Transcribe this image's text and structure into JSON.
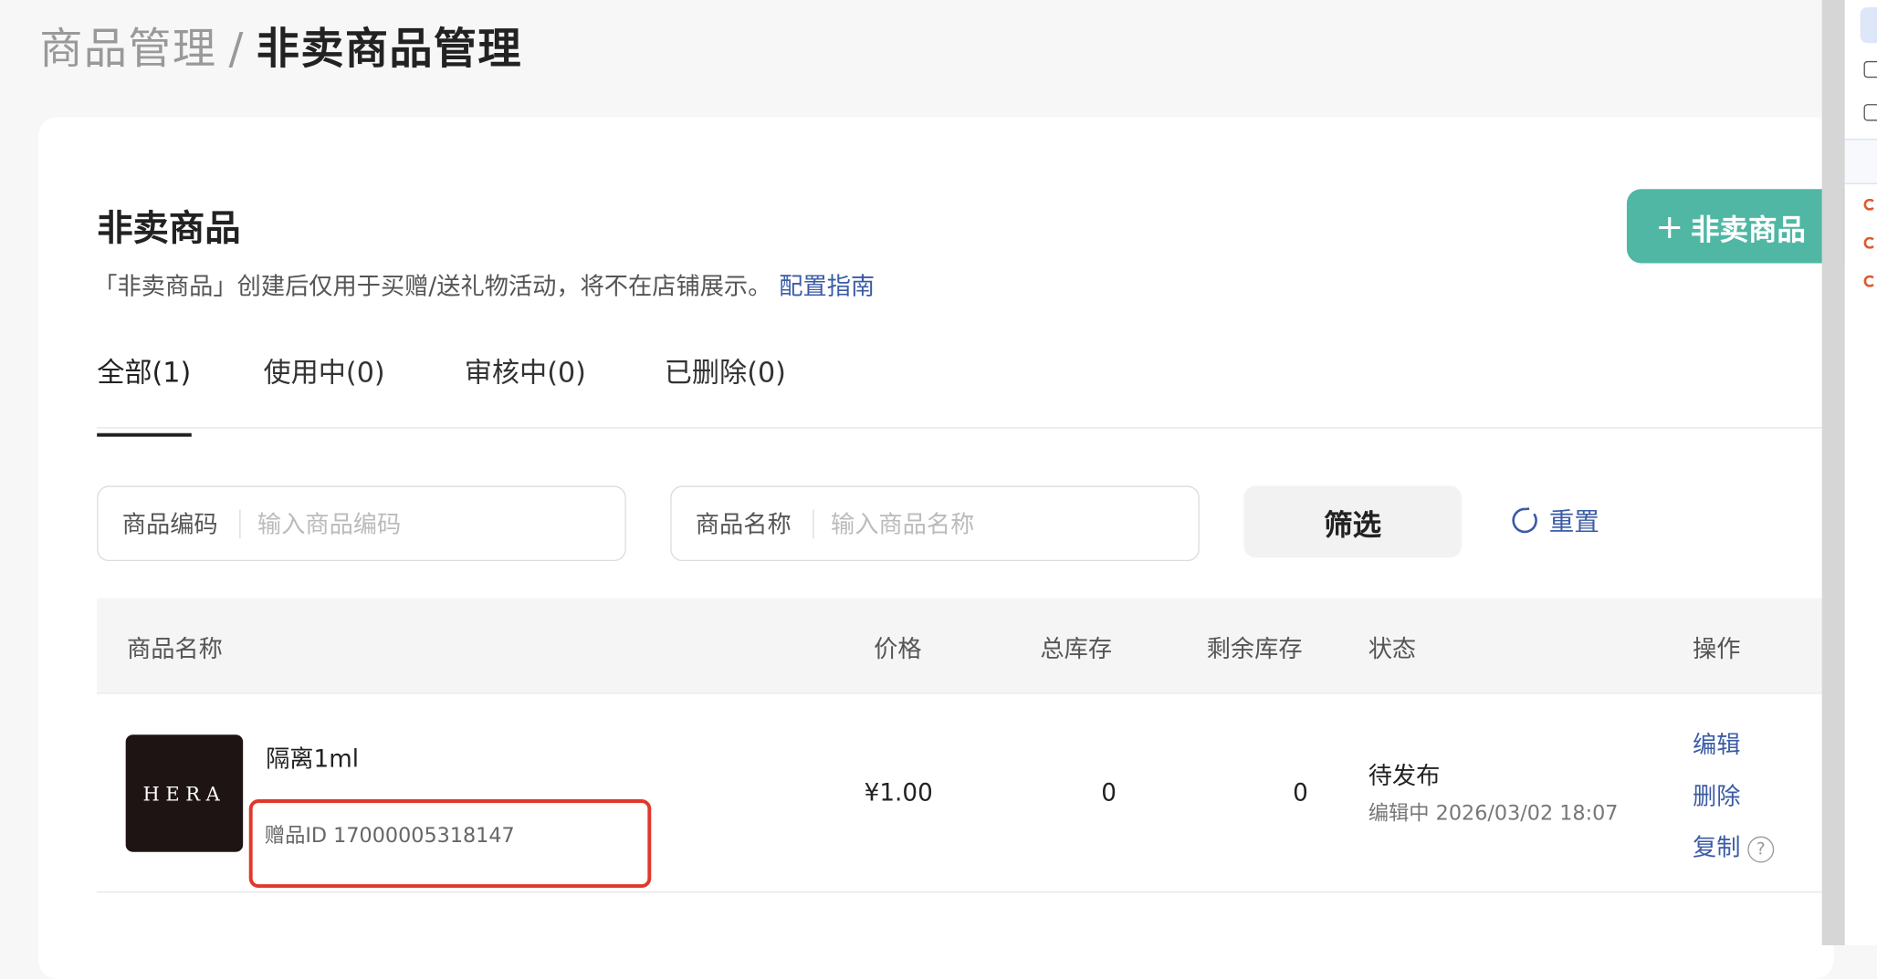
{
  "breadcrumb": {
    "parent": "商品管理",
    "separator": "/",
    "current": "非卖商品管理"
  },
  "header": {
    "title": "非卖商品",
    "description": "「非卖商品」创建后仅用于买赠/送礼物活动，将不在店铺展示。",
    "guide_link": "配置指南",
    "add_button": "非卖商品",
    "add_icon": "plus-icon"
  },
  "tabs": [
    {
      "label": "全部(1)",
      "active": true
    },
    {
      "label": "使用中(0)",
      "active": false
    },
    {
      "label": "审核中(0)",
      "active": false
    },
    {
      "label": "已删除(0)",
      "active": false
    }
  ],
  "filters": {
    "code": {
      "label": "商品编码",
      "placeholder": "输入商品编码",
      "value": ""
    },
    "name": {
      "label": "商品名称",
      "placeholder": "输入商品名称",
      "value": ""
    },
    "submit": "筛选",
    "reset": "重置",
    "reset_icon": "refresh-icon"
  },
  "table": {
    "columns": [
      "商品名称",
      "价格",
      "总库存",
      "剩余库存",
      "状态",
      "操作"
    ],
    "rows": [
      {
        "thumb_text": "HERA",
        "name": "隔离1ml",
        "gift_id": "赠品ID 17000005318147",
        "price": "¥1.00",
        "total_stock": "0",
        "remaining_stock": "0",
        "status": "待发布",
        "status_detail": "编辑中 2026/03/02 18:07",
        "actions": [
          "编辑",
          "删除",
          "复制"
        ],
        "help_icon": "question-circle-icon"
      }
    ]
  },
  "colors": {
    "accent": "#4fb7a4",
    "link": "#3b5ba5",
    "highlight": "#e0392b"
  }
}
